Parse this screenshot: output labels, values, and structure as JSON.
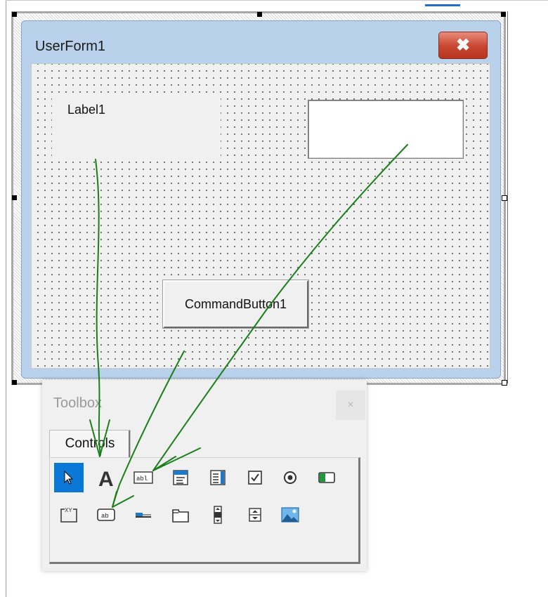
{
  "form": {
    "title": "UserForm1",
    "close_glyph": "✖",
    "label_text": "Label1",
    "command_button_label": "CommandButton1",
    "textbox_value": ""
  },
  "toolbox": {
    "title": "Toolbox",
    "close_glyph": "×",
    "tab_label": "Controls",
    "tools_row1": [
      "pointer-icon",
      "label-icon",
      "textbox-icon",
      "combobox-icon",
      "listbox-icon",
      "checkbox-icon",
      "optionbutton-icon",
      "togglebutton-icon"
    ],
    "tools_row2": [
      "frame-icon",
      "commandbutton-icon",
      "tabstrip-icon",
      "multipage-icon",
      "scrollbar-icon",
      "spinbutton-icon",
      "image-icon"
    ]
  },
  "colors": {
    "form_title_bar": "#b9d1ea",
    "close_button": "#c8452f",
    "selected_tool": "#0b78d7",
    "annotation_arrows": "#1a7f1a"
  }
}
